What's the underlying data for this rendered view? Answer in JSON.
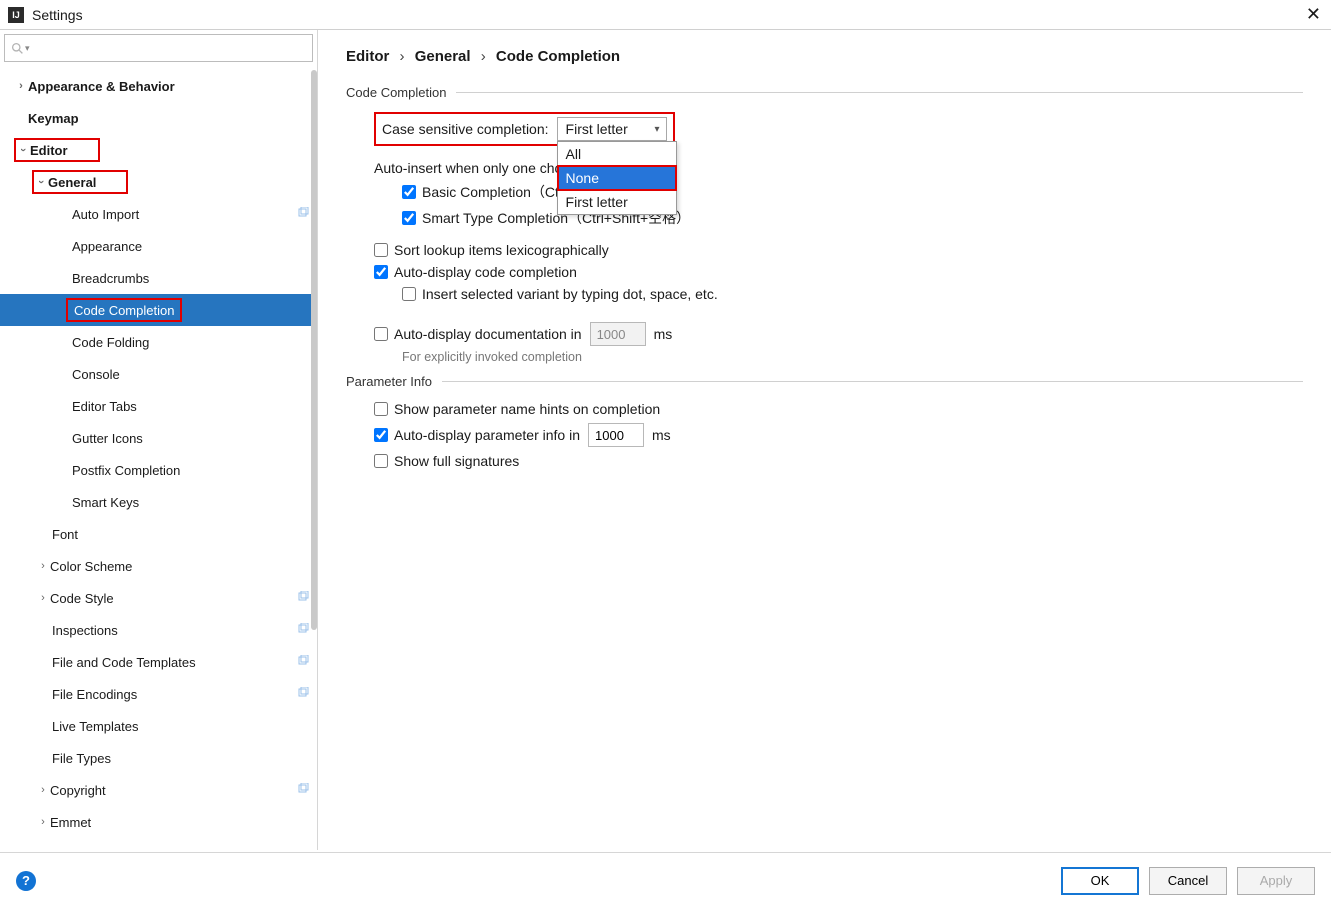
{
  "window": {
    "title": "Settings",
    "app_icon_text": "IJ"
  },
  "search": {
    "placeholder": ""
  },
  "tree": {
    "appearance_behavior": "Appearance & Behavior",
    "keymap": "Keymap",
    "editor": "Editor",
    "general": "General",
    "auto_import": "Auto Import",
    "appearance": "Appearance",
    "breadcrumbs": "Breadcrumbs",
    "code_completion": "Code Completion",
    "code_folding": "Code Folding",
    "console": "Console",
    "editor_tabs": "Editor Tabs",
    "gutter_icons": "Gutter Icons",
    "postfix_completion": "Postfix Completion",
    "smart_keys": "Smart Keys",
    "font": "Font",
    "color_scheme": "Color Scheme",
    "code_style": "Code Style",
    "inspections": "Inspections",
    "file_code_templates": "File and Code Templates",
    "file_encodings": "File Encodings",
    "live_templates": "Live Templates",
    "file_types": "File Types",
    "copyright": "Copyright",
    "emmet": "Emmet"
  },
  "breadcrumb": {
    "p1": "Editor",
    "p2": "General",
    "p3": "Code Completion",
    "sep": "›"
  },
  "sections": {
    "code_completion": "Code Completion",
    "parameter_info": "Parameter Info"
  },
  "form": {
    "case_sensitive_label": "Case sensitive completion:",
    "case_sensitive_value": "First letter",
    "dropdown_all": "All",
    "dropdown_none": "None",
    "dropdown_first_letter": "First letter",
    "auto_insert_label": "Auto-insert when only one choice on:",
    "basic_completion": "Basic Completion（Ctrl+空格）",
    "smart_type_completion": "Smart Type Completion（Ctrl+Shift+空格）",
    "sort_lookup": "Sort lookup items lexicographically",
    "auto_display_cc": "Auto-display code completion",
    "insert_selected_variant": "Insert selected variant by typing dot, space, etc.",
    "auto_display_doc_prefix": "Auto-display documentation in",
    "auto_display_doc_value": "1000",
    "ms": "ms",
    "explicit_hint": "For explicitly invoked completion",
    "show_param_hints": "Show parameter name hints on completion",
    "auto_param_info_prefix": "Auto-display parameter info in",
    "auto_param_info_value": "1000",
    "show_full_sig": "Show full signatures"
  },
  "footer": {
    "ok": "OK",
    "cancel": "Cancel",
    "apply": "Apply"
  }
}
